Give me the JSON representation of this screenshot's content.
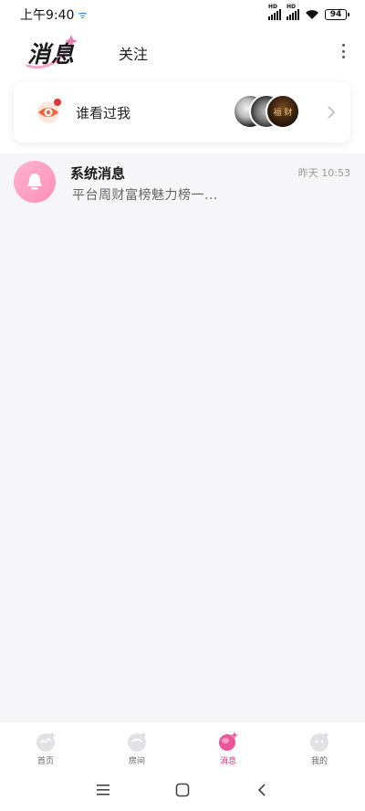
{
  "status_bar": {
    "time": "上午9:40",
    "battery": "94",
    "sim1_label": "HD",
    "sim2_label": "HD"
  },
  "header": {
    "title": "消息",
    "follow_tab": "关注"
  },
  "viewer_card": {
    "label": "谁看过我",
    "avatar2_text": "福 财"
  },
  "messages": [
    {
      "title": "系统消息",
      "time": "昨天 10:53",
      "preview": "平台周财富榜魅力榜一..."
    }
  ],
  "bottom_nav": {
    "items": [
      {
        "label": "首页",
        "active": false
      },
      {
        "label": "房间",
        "active": false
      },
      {
        "label": "消息",
        "active": true
      },
      {
        "label": "我的",
        "active": false
      }
    ]
  },
  "colors": {
    "accent_pink": "#d0357a",
    "bell_pink": "#ff8fb6",
    "eye_orange": "#f0643c"
  }
}
